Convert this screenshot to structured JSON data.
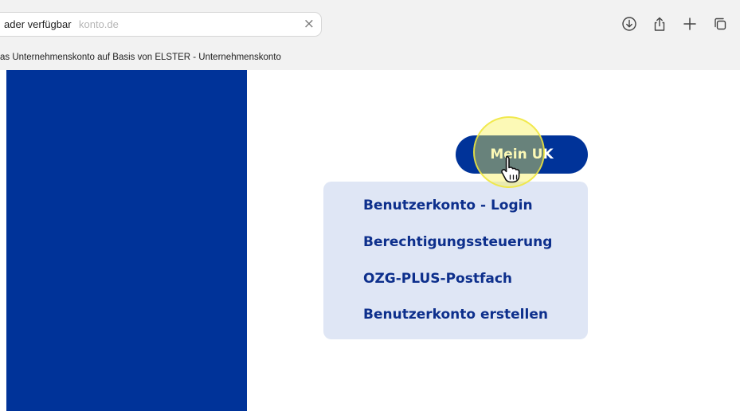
{
  "browser": {
    "url_text": "ader verfügbar",
    "url_ghost": "konto.de",
    "tab_title": "as Unternehmenskonto auf Basis von ELSTER - Unternehmenskonto",
    "icons": [
      "clear-icon",
      "download-icon",
      "share-icon",
      "new-tab-icon",
      "tabs-overview-icon"
    ]
  },
  "page": {
    "sidepanel_color": "#003399",
    "mein_uk_button": "Mein UK",
    "menu": {
      "items": [
        "Benutzerkonto - Login",
        "Berechtigungssteuerung",
        "OZG-PLUS-Postfach",
        "Benutzerkonto erstellen"
      ],
      "background": "#dfe6f5",
      "text_color": "#0d2f8c"
    },
    "cursor": "hand-pointer-icon"
  }
}
